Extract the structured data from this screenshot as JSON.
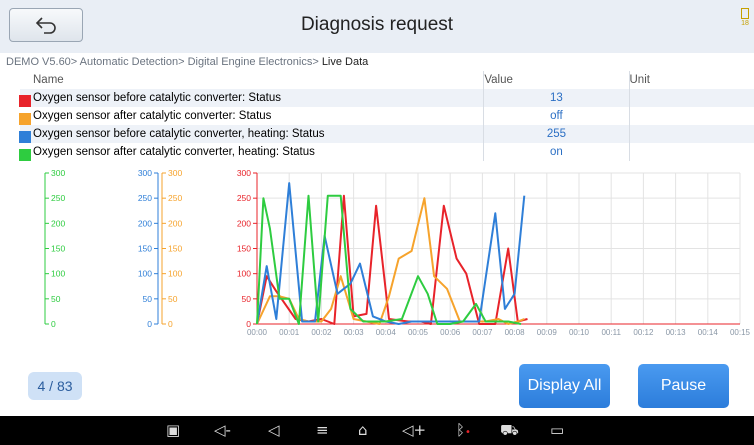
{
  "header": {
    "title": "Diagnosis request",
    "battery_text": "18"
  },
  "breadcrumb": {
    "path": "DEMO V5.60> Automatic Detection> Digital Engine Electronics> ",
    "current": "Live Data"
  },
  "table": {
    "headers": {
      "name": "Name",
      "value": "Value",
      "unit": "Unit"
    },
    "rows": [
      {
        "name": "Oxygen sensor before catalytic converter: Status",
        "value": "13",
        "unit": "",
        "color": "#e8232a"
      },
      {
        "name": "Oxygen sensor after catalytic converter: Status",
        "value": "off",
        "unit": "",
        "color": "#f6a32c"
      },
      {
        "name": "Oxygen sensor before catalytic converter, heating: Status",
        "value": "255",
        "unit": "",
        "color": "#2f7fd8"
      },
      {
        "name": "Oxygen sensor after catalytic converter, heating: Status",
        "value": "on",
        "unit": "",
        "color": "#2ecc40"
      }
    ]
  },
  "chart_data": {
    "type": "line",
    "x": [
      "00:00",
      "00:01",
      "00:02",
      "00:03",
      "00:04",
      "00:05",
      "00:06",
      "00:07",
      "00:08",
      "00:09",
      "00:10",
      "00:11",
      "00:12",
      "00:13",
      "00:14",
      "00:15"
    ],
    "ylim": [
      0,
      300
    ],
    "yticks": [
      "0",
      "50",
      "100",
      "150",
      "200",
      "250",
      "300"
    ],
    "axis_colors": [
      "#2ecc40",
      "#2f7fd8",
      "#f6a32c",
      "#e8232a"
    ],
    "series": [
      {
        "color": "#e8232a",
        "points": [
          [
            0.0,
            0
          ],
          [
            0.3,
            95
          ],
          [
            0.6,
            65
          ],
          [
            1.2,
            10
          ],
          [
            1.6,
            5
          ],
          [
            2.0,
            10
          ],
          [
            2.4,
            0
          ],
          [
            2.7,
            255
          ],
          [
            3.0,
            15
          ],
          [
            3.4,
            20
          ],
          [
            3.7,
            235
          ],
          [
            4.1,
            10
          ],
          [
            4.7,
            5
          ],
          [
            5.1,
            5
          ],
          [
            5.4,
            0
          ],
          [
            5.8,
            235
          ],
          [
            6.2,
            130
          ],
          [
            6.5,
            100
          ],
          [
            6.9,
            0
          ],
          [
            7.4,
            0
          ],
          [
            7.8,
            150
          ],
          [
            8.1,
            5
          ],
          [
            8.4,
            10
          ]
        ]
      },
      {
        "color": "#f6a32c",
        "points": [
          [
            0.0,
            0
          ],
          [
            0.4,
            55
          ],
          [
            0.7,
            55
          ],
          [
            1.0,
            50
          ],
          [
            1.3,
            10
          ],
          [
            1.6,
            5
          ],
          [
            2.0,
            5
          ],
          [
            2.3,
            30
          ],
          [
            2.6,
            95
          ],
          [
            3.0,
            10
          ],
          [
            3.4,
            5
          ],
          [
            3.8,
            0
          ],
          [
            4.1,
            55
          ],
          [
            4.4,
            130
          ],
          [
            4.8,
            145
          ],
          [
            5.2,
            250
          ],
          [
            5.5,
            95
          ],
          [
            5.9,
            70
          ],
          [
            6.3,
            5
          ],
          [
            6.7,
            5
          ],
          [
            7.1,
            5
          ],
          [
            7.5,
            10
          ],
          [
            7.8,
            0
          ],
          [
            8.1,
            5
          ],
          [
            8.3,
            10
          ]
        ]
      },
      {
        "color": "#2f7fd8",
        "points": [
          [
            0.0,
            0
          ],
          [
            0.3,
            115
          ],
          [
            0.6,
            10
          ],
          [
            1.0,
            280
          ],
          [
            1.4,
            5
          ],
          [
            1.8,
            5
          ],
          [
            2.1,
            175
          ],
          [
            2.5,
            60
          ],
          [
            2.9,
            80
          ],
          [
            3.2,
            120
          ],
          [
            3.6,
            15
          ],
          [
            4.0,
            5
          ],
          [
            4.4,
            0
          ],
          [
            4.8,
            5
          ],
          [
            5.2,
            5
          ],
          [
            5.6,
            5
          ],
          [
            6.0,
            5
          ],
          [
            6.5,
            5
          ],
          [
            6.9,
            5
          ],
          [
            7.4,
            220
          ],
          [
            7.7,
            30
          ],
          [
            8.0,
            60
          ],
          [
            8.3,
            255
          ]
        ]
      },
      {
        "color": "#2ecc40",
        "points": [
          [
            0.0,
            0
          ],
          [
            0.2,
            250
          ],
          [
            0.4,
            190
          ],
          [
            0.7,
            50
          ],
          [
            1.0,
            50
          ],
          [
            1.3,
            0
          ],
          [
            1.6,
            255
          ],
          [
            1.9,
            5
          ],
          [
            2.2,
            255
          ],
          [
            2.6,
            255
          ],
          [
            2.9,
            30
          ],
          [
            3.3,
            5
          ],
          [
            3.7,
            5
          ],
          [
            4.0,
            5
          ],
          [
            4.5,
            10
          ],
          [
            5.0,
            95
          ],
          [
            5.3,
            60
          ],
          [
            5.6,
            0
          ],
          [
            6.0,
            0
          ],
          [
            6.4,
            5
          ],
          [
            6.8,
            40
          ],
          [
            7.1,
            5
          ],
          [
            7.5,
            5
          ],
          [
            7.8,
            5
          ],
          [
            8.2,
            0
          ]
        ]
      }
    ]
  },
  "pager": {
    "text": "4 / 83"
  },
  "buttons": {
    "display_all": "Display All",
    "pause": "Pause"
  },
  "nav_icons": [
    "gallery-icon",
    "volume-down-icon",
    "back-nav-icon",
    "menu-icon",
    "home-icon",
    "volume-up-icon",
    "bluetooth-icon",
    "car-diagnostic-icon",
    "screen-record-icon"
  ]
}
